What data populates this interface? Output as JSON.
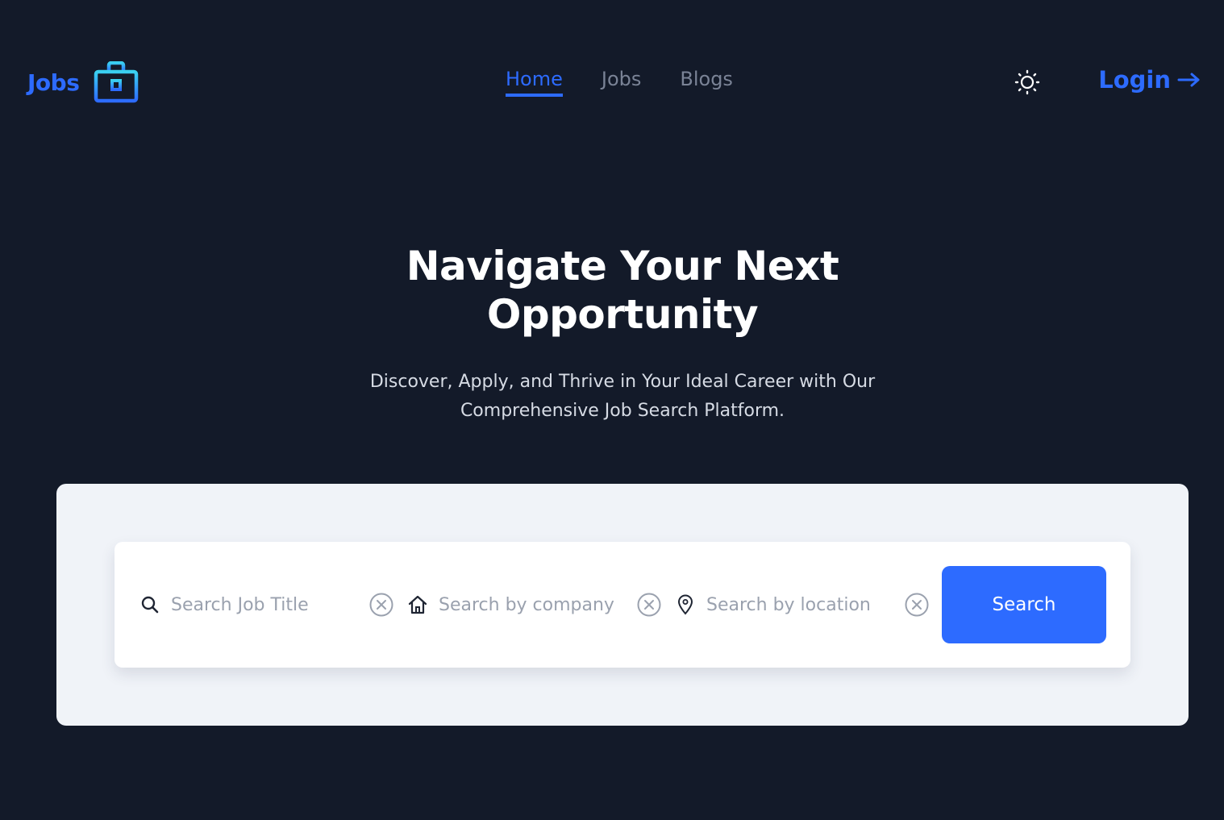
{
  "brand": {
    "name": "Jobs",
    "icon": "briefcase-icon",
    "color": "#2d6bff"
  },
  "nav": {
    "items": [
      {
        "label": "Home",
        "active": true
      },
      {
        "label": "Jobs",
        "active": false
      },
      {
        "label": "Blogs",
        "active": false
      }
    ]
  },
  "header": {
    "theme_toggle_icon": "sun-icon",
    "login_label": "Login",
    "login_icon": "arrow-right-icon"
  },
  "hero": {
    "title_line1": "Navigate Your Next",
    "title_line2": "Opportunity",
    "subtitle_line1": "Discover, Apply, and Thrive in Your Ideal Career with Our",
    "subtitle_line2": "Comprehensive Job Search Platform."
  },
  "search": {
    "job_title": {
      "placeholder": "Search Job Title",
      "value": "",
      "icon": "search-icon"
    },
    "company": {
      "placeholder": "Search by company",
      "value": "",
      "icon": "home-icon"
    },
    "location": {
      "placeholder": "Search by location",
      "value": "",
      "icon": "location-pin-icon"
    },
    "clear_icon": "clear-circle-icon",
    "button_label": "Search"
  },
  "colors": {
    "background": "#131a29",
    "accent": "#2d6bff",
    "panel": "#f0f3f8",
    "card": "#ffffff"
  }
}
